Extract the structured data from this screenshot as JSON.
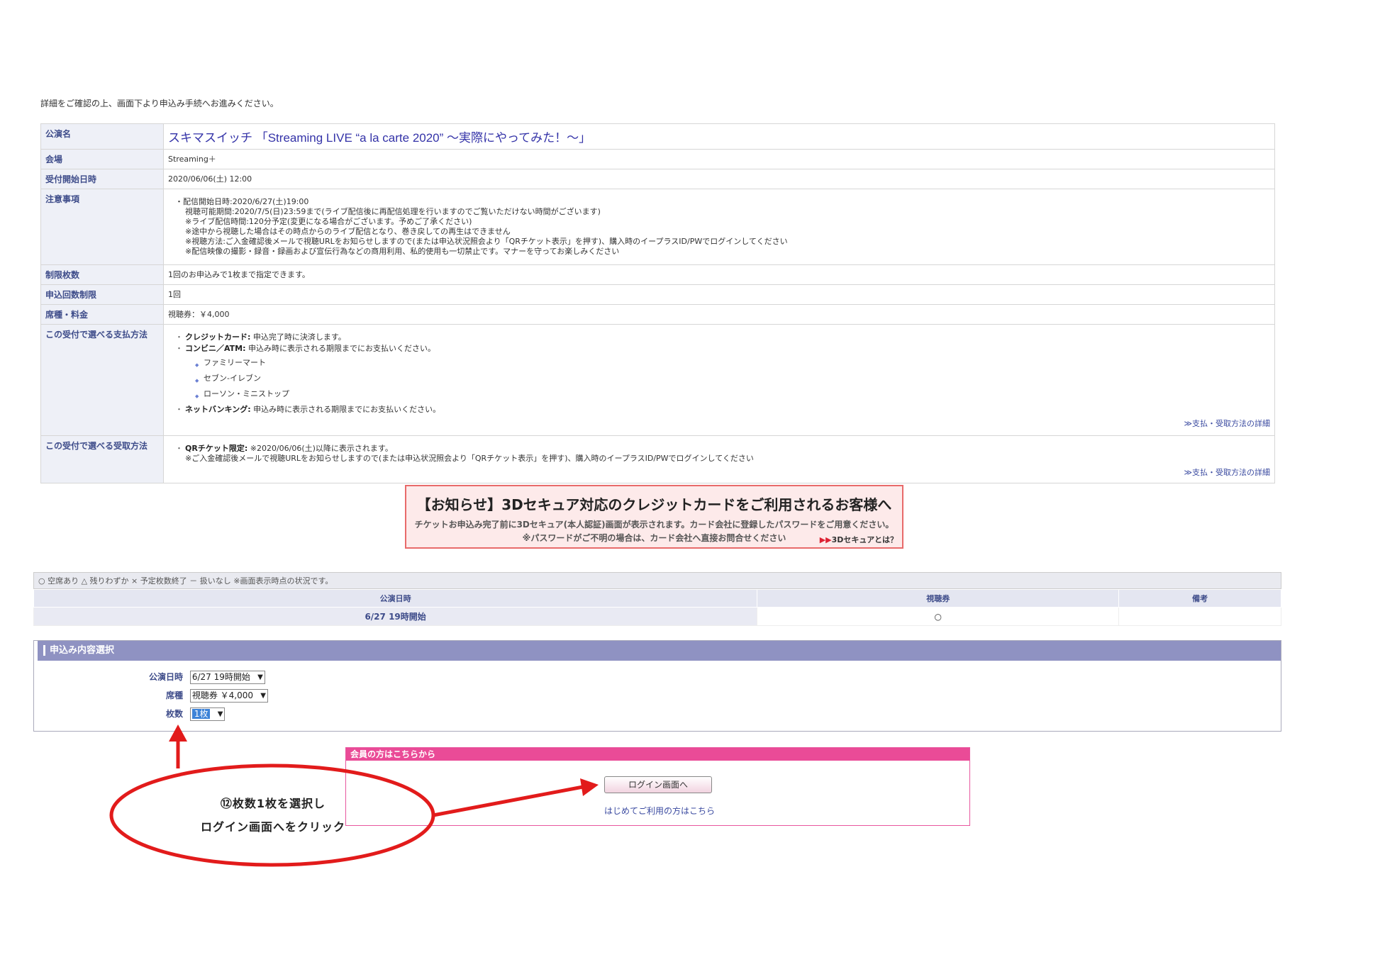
{
  "intro": "詳細をご確認の上、画面下より申込み手続へお進みください。",
  "details": {
    "title_label": "公演名",
    "title": "スキマスイッチ 「Streaming LIVE “a la carte 2020” ～実際にやってみた！～」",
    "venue_label": "会場",
    "venue": "Streaming＋",
    "start_label": "受付開始日時",
    "start": "2020/06/06(土) 12:00",
    "notes_label": "注意事項",
    "notes": [
      "配信開始日時:2020/6/27(土)19:00",
      "視聴可能期間:2020/7/5(日)23:59まで(ライブ配信後に再配信処理を行いますのでご覧いただけない時間がございます)",
      "※ライブ配信時間:120分予定(変更になる場合がございます。予めご了承ください)",
      "※途中から視聴した場合はその時点からのライブ配信となり、巻き戻しての再生はできません",
      "※視聴方法:ご入金確認後メールで視聴URLをお知らせしますので(または申込状況照会より「QRチケット表示」を押す)、購入時のイープラスID/PWでログインしてください",
      "※配信映像の撮影・録音・録画および宣伝行為などの商用利用、私的使用も一切禁止です。マナーを守ってお楽しみください"
    ],
    "limit_label": "制限枚数",
    "limit": "1回のお申込みで1枚まで指定できます。",
    "count_label": "申込回数制限",
    "count": "1回",
    "seat_label": "席種・料金",
    "seat": "視聴券：￥4,000",
    "pay_label": "この受付で選べる支払方法",
    "pay_credit_b": "クレジットカード:",
    "pay_credit": " 申込完了時に決済します。",
    "pay_conv_b": "コンビニ／ATM:",
    "pay_conv": " 申込み時に表示される期限までにお支払いください。",
    "stores": [
      "ファミリーマート",
      "セブン-イレブン",
      "ローソン・ミニストップ"
    ],
    "pay_net_b": "ネットバンキング:",
    "pay_net": " 申込み時に表示される期限までにお支払いください。",
    "pay_link": "≫支払・受取方法の詳細",
    "recv_label": "この受付で選べる受取方法",
    "recv_b": "QRチケット限定:",
    "recv": " ※2020/06/06(土)以降に表示されます。",
    "recv2": "※ご入金確認後メールで視聴URLをお知らせしますので(または申込状況照会より「QRチケット表示」を押す)、購入時のイープラスID/PWでログインしてください",
    "recv_link": "≫支払・受取方法の詳細"
  },
  "notice": {
    "title": "【お知らせ】3Dセキュア対応のクレジットカードをご利用されるお客様へ",
    "line1": "チケットお申込み完了前に3Dセキュア(本人認証)画面が表示されます。カード会社に登録したパスワードをご用意ください。",
    "line2": "※パスワードがご不明の場合は、カード会社へ直接お問合せください",
    "link_arrow": "▶▶",
    "link": "3Dセキュアとは？"
  },
  "availability": {
    "legend": "○ 空席あり △ 残りわずか × 予定枚数終了 － 扱いなし ※画面表示時点の状況です。",
    "headers": [
      "公演日時",
      "視聴券",
      "備考"
    ],
    "rows": [
      [
        "6/27 19時開始",
        "○",
        ""
      ]
    ]
  },
  "selection": {
    "heading": "申込み内容選択",
    "date_label": "公演日時",
    "date_value": "6/27 19時開始",
    "seat_label": "席種",
    "seat_value": "視聴券 ￥4,000",
    "qty_label": "枚数",
    "qty_value": "1枚"
  },
  "login": {
    "heading": "会員の方はこちらから",
    "button": "ログイン画面へ",
    "first_time": "はじめてご利用の方はこちら"
  },
  "annotation": {
    "line1": "⑫枚数1枚を選択し",
    "line2": "ログイン画面へをクリック"
  },
  "colors": {
    "accent": "#3433a8",
    "annotation": "#e21b1b",
    "login": "#ea4b97",
    "section": "#8f92c2"
  }
}
